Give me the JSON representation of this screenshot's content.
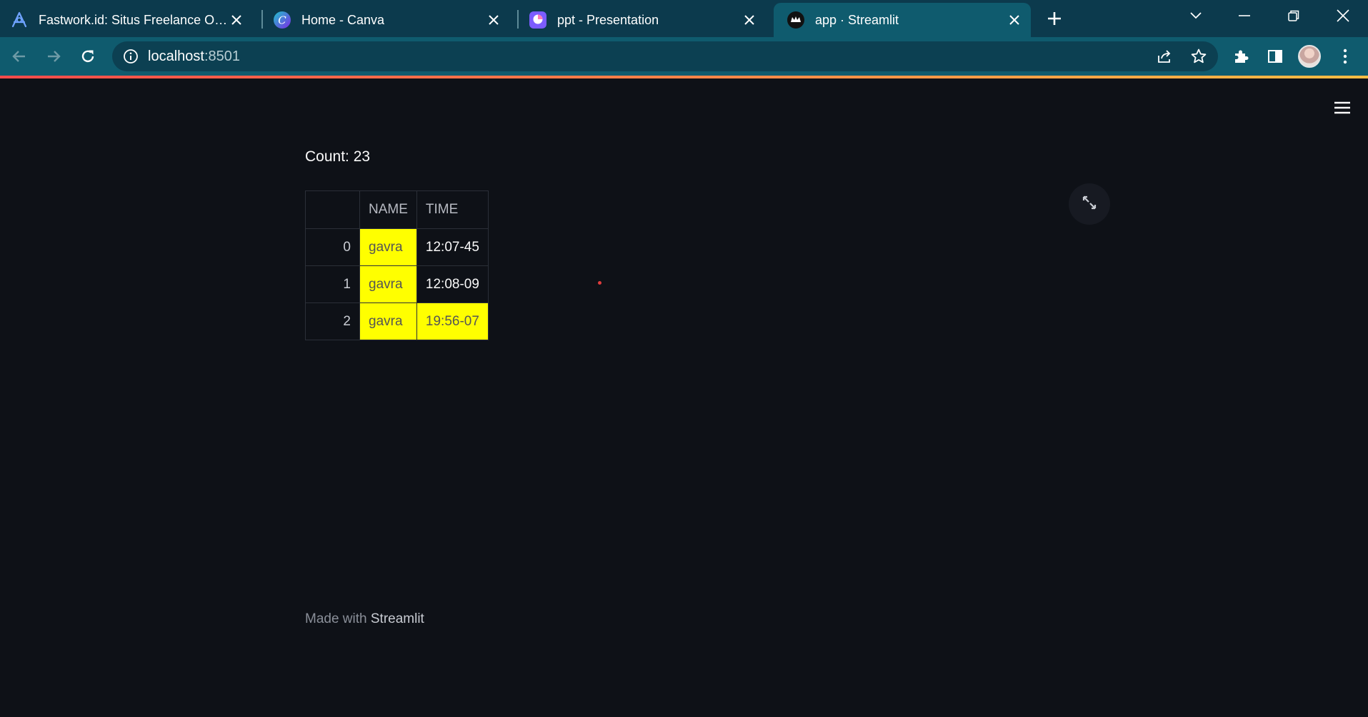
{
  "browser": {
    "tabs": [
      {
        "title": "Fastwork.id: Situs Freelance Online",
        "icon": "fastwork-icon",
        "active": false
      },
      {
        "title": "Home - Canva",
        "icon": "canva-icon",
        "active": false
      },
      {
        "title": "ppt - Presentation",
        "icon": "presentation-icon",
        "active": false
      },
      {
        "title": "app · Streamlit",
        "icon": "streamlit-icon",
        "active": true
      }
    ],
    "url_host": "localhost",
    "url_port": ":8501"
  },
  "app": {
    "count_label": "Count: 23",
    "table": {
      "columns": [
        "",
        "NAME",
        "TIME"
      ],
      "rows": [
        {
          "index": "0",
          "name": "gavra",
          "time": "12:07-45",
          "name_highlight": true,
          "time_highlight": false
        },
        {
          "index": "1",
          "name": "gavra",
          "time": "12:08-09",
          "name_highlight": true,
          "time_highlight": false
        },
        {
          "index": "2",
          "name": "gavra",
          "time": "19:56-07",
          "name_highlight": true,
          "time_highlight": true
        }
      ],
      "highlight_color": "#ffff00"
    },
    "footer": {
      "prefix": "Made with ",
      "brand": "Streamlit"
    }
  },
  "colors": {
    "tabstrip": "#0c3a4d",
    "toolbar": "#0f5b6e",
    "app_background": "#0e1117",
    "accent": "#ff4b4b"
  }
}
